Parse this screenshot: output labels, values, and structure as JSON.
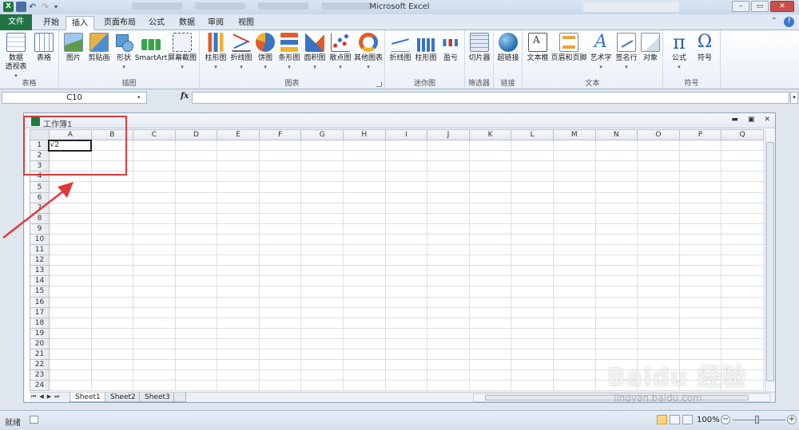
{
  "window": {
    "title": "Microsoft Excel"
  },
  "tabs": {
    "file": "文件",
    "items": [
      {
        "label": "开始",
        "active": false
      },
      {
        "label": "插入",
        "active": true
      },
      {
        "label": "页面布局",
        "active": false
      },
      {
        "label": "公式",
        "active": false
      },
      {
        "label": "数据",
        "active": false
      },
      {
        "label": "审阅",
        "active": false
      },
      {
        "label": "视图",
        "active": false
      }
    ]
  },
  "ribbon": {
    "groups": {
      "tables": "表格",
      "illustrations": "插图",
      "charts": "图表",
      "sparklines": "迷你图",
      "filter": "筛选器",
      "links": "链接",
      "text": "文本",
      "symbols": "符号"
    },
    "buttons": {
      "pivot_line1": "数据",
      "pivot_line2": "透视表",
      "table": "表格",
      "picture": "图片",
      "clipart": "剪贴画",
      "shapes": "形状",
      "smartart": "SmartArt",
      "screenshot": "屏幕截图",
      "column_chart": "柱形图",
      "line_chart": "折线图",
      "pie_chart": "饼图",
      "bar_chart": "条形图",
      "area_chart": "面积图",
      "scatter_chart": "散点图",
      "other_charts": "其他图表",
      "spark_line": "折线图",
      "spark_column": "柱形图",
      "spark_winloss": "盈亏",
      "slicer": "切片器",
      "hyperlink": "超链接",
      "textbox": "文本框",
      "header_footer": "页眉和页脚",
      "wordart": "艺术字",
      "signature": "签名行",
      "object": "对象",
      "equation": "公式",
      "symbol": "符号"
    }
  },
  "formula_bar": {
    "name_box": "C10",
    "fx": "fx",
    "value": ""
  },
  "workbook": {
    "name": "工作簿1",
    "columns": [
      "A",
      "B",
      "C",
      "D",
      "E",
      "F",
      "G",
      "H",
      "I",
      "J",
      "K",
      "L",
      "M",
      "N",
      "O",
      "P",
      "Q"
    ],
    "rows": [
      "1",
      "2",
      "3",
      "4",
      "5",
      "6",
      "7",
      "8",
      "9",
      "10",
      "11",
      "12",
      "13",
      "14",
      "15",
      "16",
      "17",
      "18",
      "19",
      "20",
      "21",
      "22",
      "23",
      "24"
    ],
    "cell_a1": "√2",
    "sheets": [
      "Sheet1",
      "Sheet2",
      "Sheet3"
    ],
    "active_sheet": "Sheet1"
  },
  "status": {
    "ready": "就绪",
    "zoom": "100%"
  },
  "watermark": {
    "brand": "Baidu 经验",
    "url": "jingyan.baidu.com"
  },
  "colors": {
    "file_tab": "#217346",
    "annotation": "#e0393c"
  }
}
